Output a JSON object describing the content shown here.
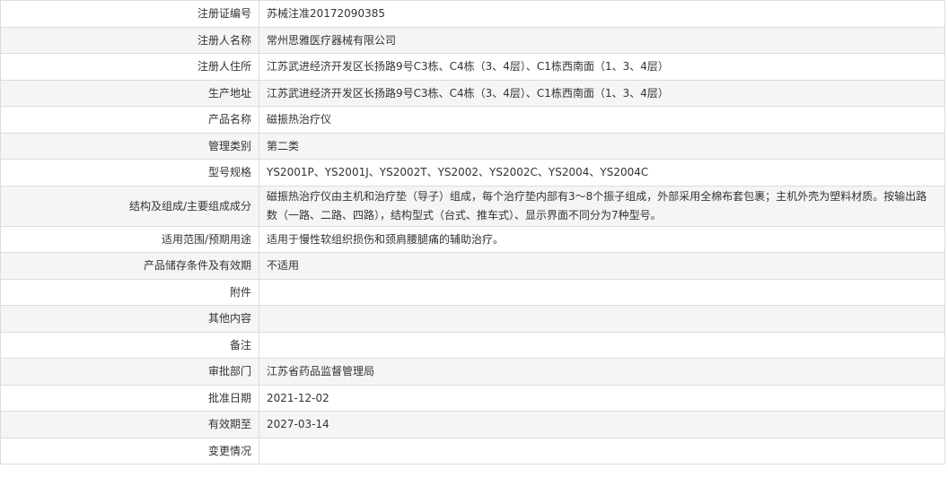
{
  "rows": [
    {
      "label": "注册证编号",
      "value": "苏械注准20172090385"
    },
    {
      "label": "注册人名称",
      "value": "常州思雅医疗器械有限公司"
    },
    {
      "label": "注册人住所",
      "value": "江苏武进经济开发区长扬路9号C3栋、C4栋（3、4层）、C1栋西南面（1、3、4层）"
    },
    {
      "label": "生产地址",
      "value": "江苏武进经济开发区长扬路9号C3栋、C4栋（3、4层）、C1栋西南面（1、3、4层）"
    },
    {
      "label": "产品名称",
      "value": "磁振热治疗仪"
    },
    {
      "label": "管理类别",
      "value": "第二类"
    },
    {
      "label": "型号规格",
      "value": "YS2001P、YS2001J、YS2002T、YS2002、YS2002C、YS2004、YS2004C"
    },
    {
      "label": "结构及组成/主要组成成分",
      "value": "磁振热治疗仪由主机和治疗垫（导子）组成，每个治疗垫内部有3～8个振子组成，外部采用全棉布套包裹；主机外壳为塑料材质。按输出路数（一路、二路、四路），结构型式（台式、推车式）、显示界面不同分为7种型号。"
    },
    {
      "label": "适用范围/预期用途",
      "value": "适用于慢性软组织损伤和颈肩腰腿痛的辅助治疗。"
    },
    {
      "label": "产品储存条件及有效期",
      "value": "不适用"
    },
    {
      "label": "附件",
      "value": ""
    },
    {
      "label": "其他内容",
      "value": ""
    },
    {
      "label": "备注",
      "value": ""
    },
    {
      "label": "审批部门",
      "value": "江苏省药品监督管理局"
    },
    {
      "label": "批准日期",
      "value": "2021-12-02"
    },
    {
      "label": "有效期至",
      "value": "2027-03-14"
    },
    {
      "label": "变更情况",
      "value": ""
    }
  ]
}
